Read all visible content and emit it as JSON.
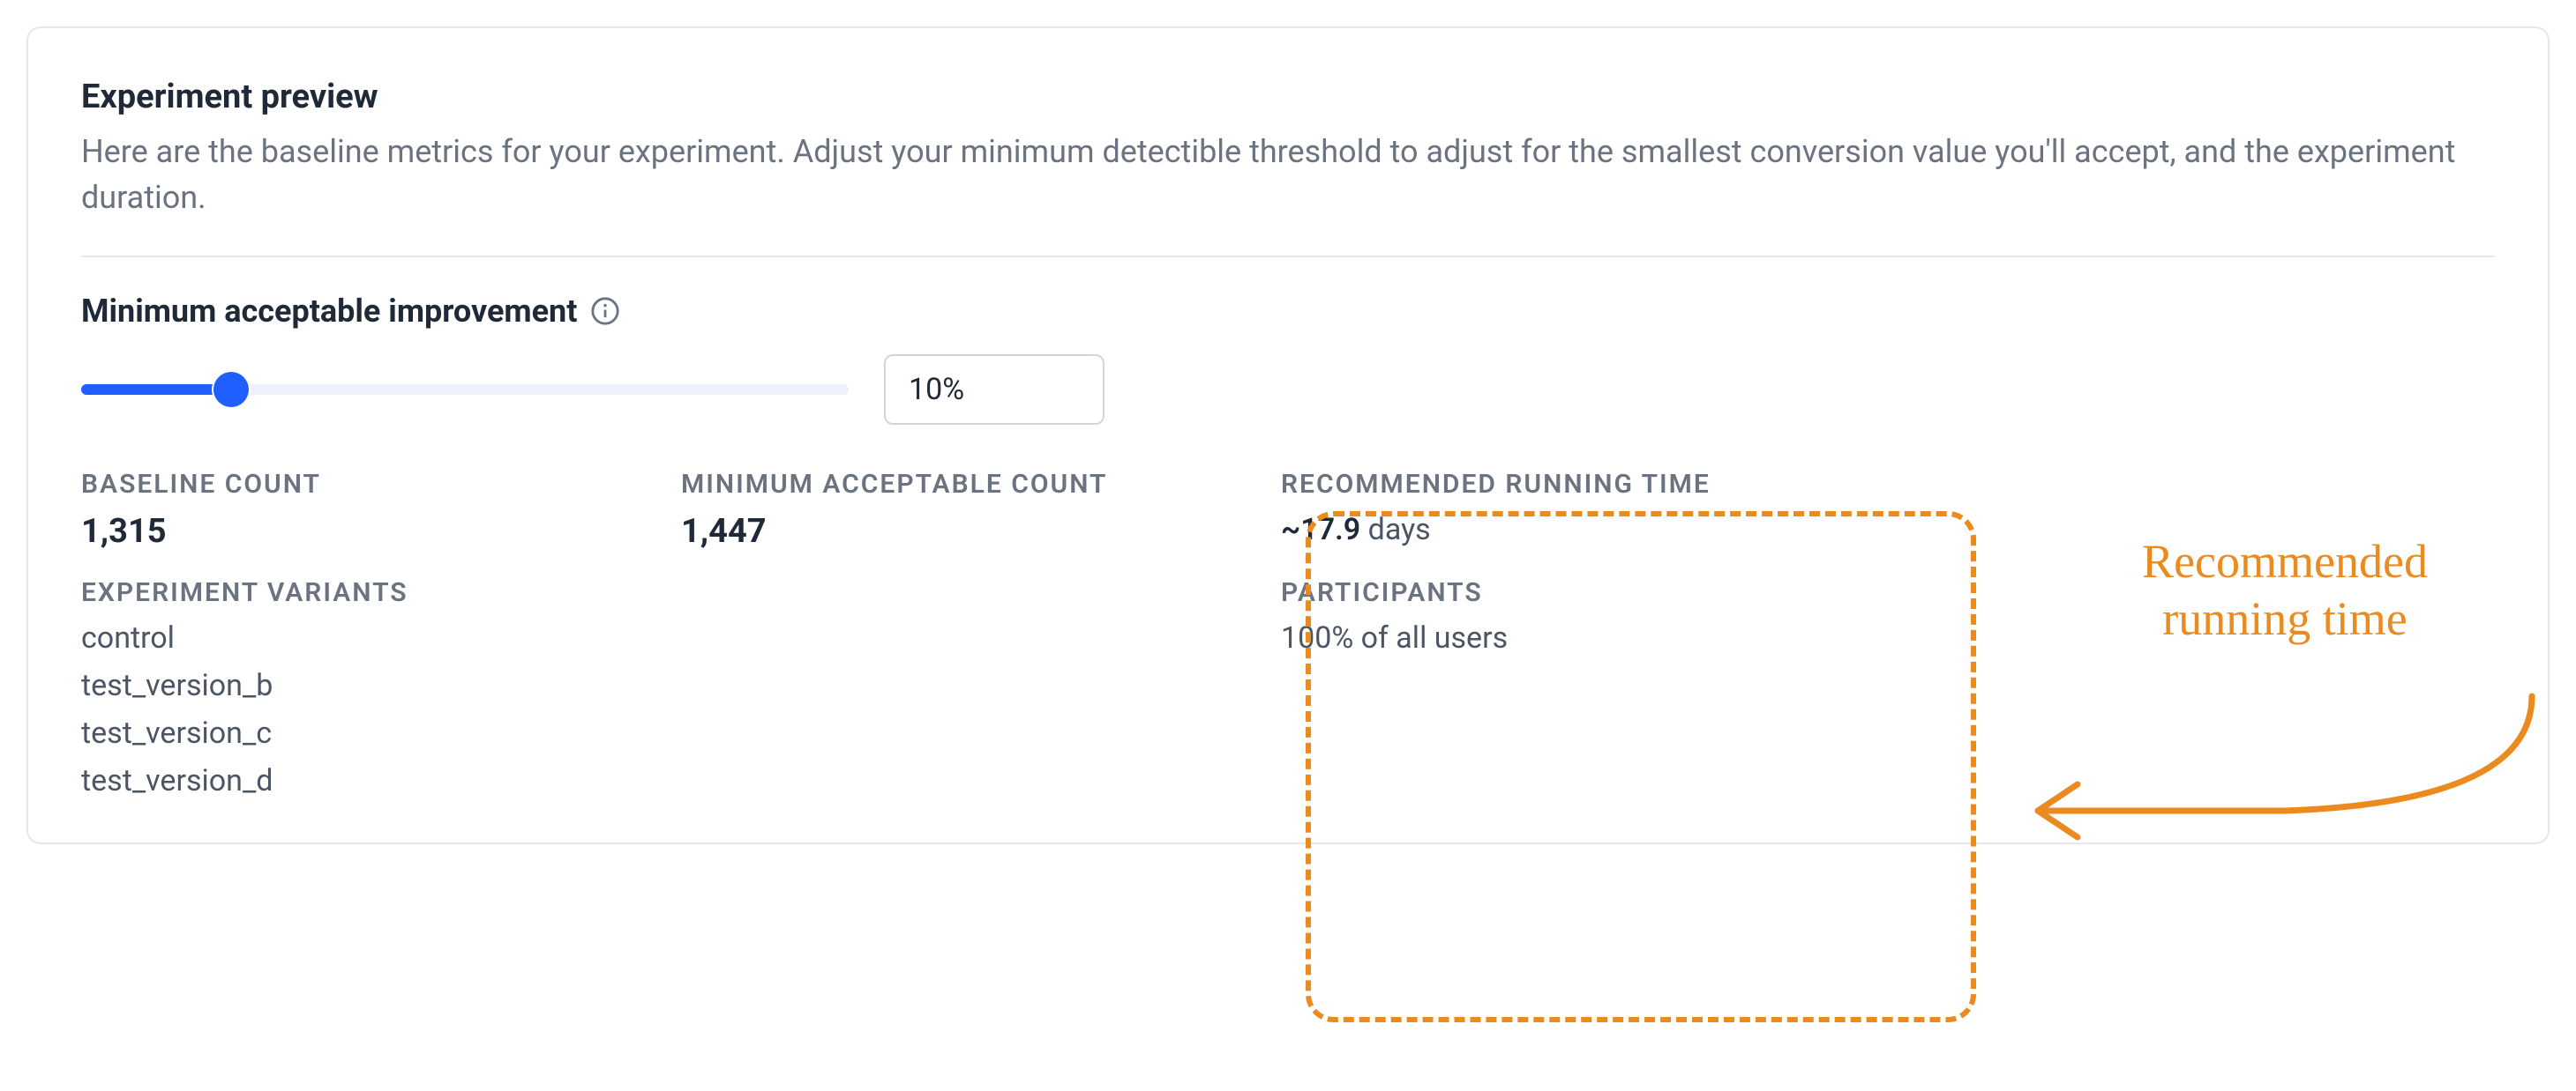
{
  "header": {
    "title": "Experiment preview",
    "description": "Here are the baseline metrics for your experiment. Adjust your minimum detectible threshold to adjust for the smallest conversion value you'll accept, and the experiment duration."
  },
  "improvement": {
    "label": "Minimum acceptable improvement",
    "info_icon": "info-icon",
    "percent_value": "10%"
  },
  "metrics": {
    "baseline_count": {
      "label": "BASELINE COUNT",
      "value": "1,315"
    },
    "min_acceptable_count": {
      "label": "MINIMUM ACCEPTABLE COUNT",
      "value": "1,447"
    },
    "recommended_time": {
      "label": "RECOMMENDED RUNNING TIME",
      "prefix": "~17.9",
      "suffix": " days"
    },
    "variants": {
      "label": "EXPERIMENT VARIANTS",
      "items": [
        "control",
        "test_version_b",
        "test_version_c",
        "test_version_d"
      ]
    },
    "participants": {
      "label": "PARTICIPANTS",
      "value": "100% of all users"
    }
  },
  "annotation": {
    "text_line1": "Recommended",
    "text_line2": "running time"
  },
  "colors": {
    "accent": "#1f5eff",
    "annotation": "#ea8a1f"
  }
}
